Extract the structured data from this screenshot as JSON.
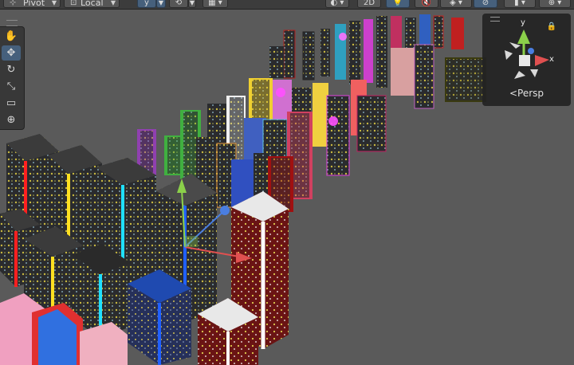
{
  "toolbar": {
    "pivot_label": "Pivot",
    "space_label": "Local",
    "snap_label": "y",
    "view_2d_label": "2D"
  },
  "tools": [
    {
      "name": "hand",
      "glyph": "✋"
    },
    {
      "name": "move",
      "glyph": "✥"
    },
    {
      "name": "rotate",
      "glyph": "↻"
    },
    {
      "name": "scale",
      "glyph": "⤡"
    },
    {
      "name": "rect",
      "glyph": "▭"
    },
    {
      "name": "transform",
      "glyph": "⊕"
    }
  ],
  "gizmo": {
    "axis_y": "y",
    "axis_x": "x",
    "projection_label": "Persp"
  },
  "colors": {
    "toolbar_bg": "#3c3c3c",
    "active_blue": "#46607c",
    "axis_x": "#e05050",
    "axis_y": "#8bd04a",
    "axis_z": "#4a7ee0",
    "viewport_bg": "#5b5b5b"
  }
}
